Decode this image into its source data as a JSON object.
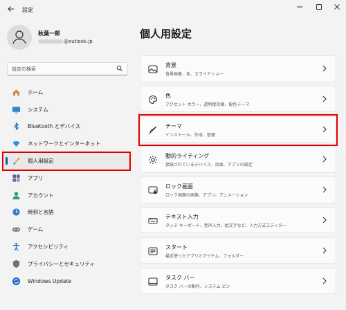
{
  "window": {
    "title": "設定"
  },
  "user": {
    "name": "秋葉一郎",
    "email_visible": "@outlook.jp"
  },
  "search": {
    "placeholder": "設定の検索"
  },
  "sidebar": {
    "items": [
      {
        "label": "ホーム",
        "icon": "home-icon"
      },
      {
        "label": "システム",
        "icon": "system-icon"
      },
      {
        "label": "Bluetooth とデバイス",
        "icon": "bluetooth-icon"
      },
      {
        "label": "ネットワークとインターネット",
        "icon": "network-icon"
      },
      {
        "label": "個人用設定",
        "icon": "brush-icon",
        "active": true
      },
      {
        "label": "アプリ",
        "icon": "apps-icon"
      },
      {
        "label": "アカウント",
        "icon": "account-icon"
      },
      {
        "label": "時刻と言語",
        "icon": "time-language-icon"
      },
      {
        "label": "ゲーム",
        "icon": "gaming-icon"
      },
      {
        "label": "アクセシビリティ",
        "icon": "accessibility-icon"
      },
      {
        "label": "プライバシーとセキュリティ",
        "icon": "shield-icon"
      },
      {
        "label": "Windows Update",
        "icon": "update-icon"
      }
    ]
  },
  "main": {
    "title": "個人用設定",
    "cards": [
      {
        "title": "背景",
        "subtitle": "背景画像、色、スライドショー",
        "icon": "background-icon"
      },
      {
        "title": "色",
        "subtitle": "アクセント カラー、透明度効果、配色テーマ",
        "icon": "palette-icon"
      },
      {
        "title": "テーマ",
        "subtitle": "インストール、作成、管理",
        "icon": "theme-brush-icon"
      },
      {
        "title": "動的ライティング",
        "subtitle": "接続されているデバイス、効果、アプリの設定",
        "icon": "dynamic-lighting-icon"
      },
      {
        "title": "ロック画面",
        "subtitle": "ロック画面の画像、アプリ、アニメーション",
        "icon": "lock-screen-icon"
      },
      {
        "title": "テキスト入力",
        "subtitle": "タッチ キーボード、音声入力、絵文字など、入力方式エディター",
        "icon": "keyboard-icon"
      },
      {
        "title": "スタート",
        "subtitle": "最近使ったアプリとアイテム、フォルダー",
        "icon": "start-icon"
      },
      {
        "title": "タスク バー",
        "subtitle": "タスク バーの動作、システム ピン",
        "icon": "taskbar-icon"
      }
    ]
  },
  "colors": {
    "accent": "#005fb8",
    "highlight": "#e00000"
  }
}
